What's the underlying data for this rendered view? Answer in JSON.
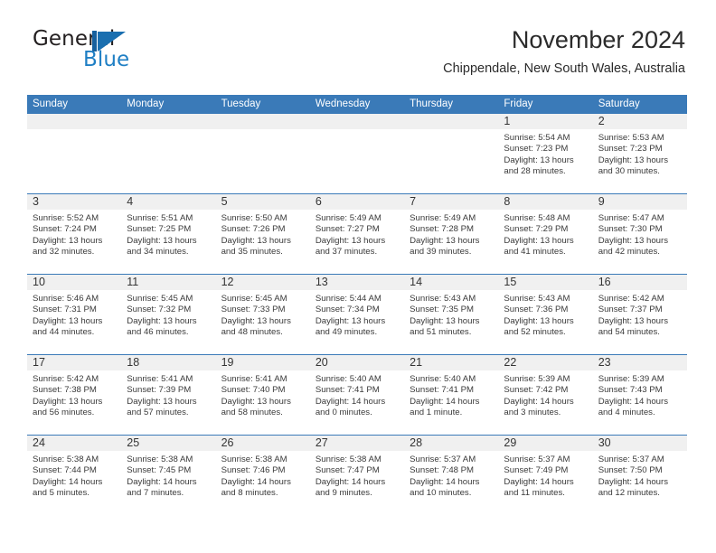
{
  "brand": {
    "name_part1": "General",
    "name_part2": "Blue",
    "mark": "blue-triangle-logo"
  },
  "header": {
    "title": "November 2024",
    "subtitle": "Chippendale, New South Wales, Australia"
  },
  "colors": {
    "header_blue": "#3a7ab8",
    "day_strip_gray": "#f0f0f0",
    "brand_blue": "#1f7fc4",
    "text": "#3a3a3a"
  },
  "weekdays": [
    "Sunday",
    "Monday",
    "Tuesday",
    "Wednesday",
    "Thursday",
    "Friday",
    "Saturday"
  ],
  "weeks": [
    [
      {
        "day": "",
        "sunrise": "",
        "sunset": "",
        "daylight1": "",
        "daylight2": ""
      },
      {
        "day": "",
        "sunrise": "",
        "sunset": "",
        "daylight1": "",
        "daylight2": ""
      },
      {
        "day": "",
        "sunrise": "",
        "sunset": "",
        "daylight1": "",
        "daylight2": ""
      },
      {
        "day": "",
        "sunrise": "",
        "sunset": "",
        "daylight1": "",
        "daylight2": ""
      },
      {
        "day": "",
        "sunrise": "",
        "sunset": "",
        "daylight1": "",
        "daylight2": ""
      },
      {
        "day": "1",
        "sunrise": "Sunrise: 5:54 AM",
        "sunset": "Sunset: 7:23 PM",
        "daylight1": "Daylight: 13 hours",
        "daylight2": "and 28 minutes."
      },
      {
        "day": "2",
        "sunrise": "Sunrise: 5:53 AM",
        "sunset": "Sunset: 7:23 PM",
        "daylight1": "Daylight: 13 hours",
        "daylight2": "and 30 minutes."
      }
    ],
    [
      {
        "day": "3",
        "sunrise": "Sunrise: 5:52 AM",
        "sunset": "Sunset: 7:24 PM",
        "daylight1": "Daylight: 13 hours",
        "daylight2": "and 32 minutes."
      },
      {
        "day": "4",
        "sunrise": "Sunrise: 5:51 AM",
        "sunset": "Sunset: 7:25 PM",
        "daylight1": "Daylight: 13 hours",
        "daylight2": "and 34 minutes."
      },
      {
        "day": "5",
        "sunrise": "Sunrise: 5:50 AM",
        "sunset": "Sunset: 7:26 PM",
        "daylight1": "Daylight: 13 hours",
        "daylight2": "and 35 minutes."
      },
      {
        "day": "6",
        "sunrise": "Sunrise: 5:49 AM",
        "sunset": "Sunset: 7:27 PM",
        "daylight1": "Daylight: 13 hours",
        "daylight2": "and 37 minutes."
      },
      {
        "day": "7",
        "sunrise": "Sunrise: 5:49 AM",
        "sunset": "Sunset: 7:28 PM",
        "daylight1": "Daylight: 13 hours",
        "daylight2": "and 39 minutes."
      },
      {
        "day": "8",
        "sunrise": "Sunrise: 5:48 AM",
        "sunset": "Sunset: 7:29 PM",
        "daylight1": "Daylight: 13 hours",
        "daylight2": "and 41 minutes."
      },
      {
        "day": "9",
        "sunrise": "Sunrise: 5:47 AM",
        "sunset": "Sunset: 7:30 PM",
        "daylight1": "Daylight: 13 hours",
        "daylight2": "and 42 minutes."
      }
    ],
    [
      {
        "day": "10",
        "sunrise": "Sunrise: 5:46 AM",
        "sunset": "Sunset: 7:31 PM",
        "daylight1": "Daylight: 13 hours",
        "daylight2": "and 44 minutes."
      },
      {
        "day": "11",
        "sunrise": "Sunrise: 5:45 AM",
        "sunset": "Sunset: 7:32 PM",
        "daylight1": "Daylight: 13 hours",
        "daylight2": "and 46 minutes."
      },
      {
        "day": "12",
        "sunrise": "Sunrise: 5:45 AM",
        "sunset": "Sunset: 7:33 PM",
        "daylight1": "Daylight: 13 hours",
        "daylight2": "and 48 minutes."
      },
      {
        "day": "13",
        "sunrise": "Sunrise: 5:44 AM",
        "sunset": "Sunset: 7:34 PM",
        "daylight1": "Daylight: 13 hours",
        "daylight2": "and 49 minutes."
      },
      {
        "day": "14",
        "sunrise": "Sunrise: 5:43 AM",
        "sunset": "Sunset: 7:35 PM",
        "daylight1": "Daylight: 13 hours",
        "daylight2": "and 51 minutes."
      },
      {
        "day": "15",
        "sunrise": "Sunrise: 5:43 AM",
        "sunset": "Sunset: 7:36 PM",
        "daylight1": "Daylight: 13 hours",
        "daylight2": "and 52 minutes."
      },
      {
        "day": "16",
        "sunrise": "Sunrise: 5:42 AM",
        "sunset": "Sunset: 7:37 PM",
        "daylight1": "Daylight: 13 hours",
        "daylight2": "and 54 minutes."
      }
    ],
    [
      {
        "day": "17",
        "sunrise": "Sunrise: 5:42 AM",
        "sunset": "Sunset: 7:38 PM",
        "daylight1": "Daylight: 13 hours",
        "daylight2": "and 56 minutes."
      },
      {
        "day": "18",
        "sunrise": "Sunrise: 5:41 AM",
        "sunset": "Sunset: 7:39 PM",
        "daylight1": "Daylight: 13 hours",
        "daylight2": "and 57 minutes."
      },
      {
        "day": "19",
        "sunrise": "Sunrise: 5:41 AM",
        "sunset": "Sunset: 7:40 PM",
        "daylight1": "Daylight: 13 hours",
        "daylight2": "and 58 minutes."
      },
      {
        "day": "20",
        "sunrise": "Sunrise: 5:40 AM",
        "sunset": "Sunset: 7:41 PM",
        "daylight1": "Daylight: 14 hours",
        "daylight2": "and 0 minutes."
      },
      {
        "day": "21",
        "sunrise": "Sunrise: 5:40 AM",
        "sunset": "Sunset: 7:41 PM",
        "daylight1": "Daylight: 14 hours",
        "daylight2": "and 1 minute."
      },
      {
        "day": "22",
        "sunrise": "Sunrise: 5:39 AM",
        "sunset": "Sunset: 7:42 PM",
        "daylight1": "Daylight: 14 hours",
        "daylight2": "and 3 minutes."
      },
      {
        "day": "23",
        "sunrise": "Sunrise: 5:39 AM",
        "sunset": "Sunset: 7:43 PM",
        "daylight1": "Daylight: 14 hours",
        "daylight2": "and 4 minutes."
      }
    ],
    [
      {
        "day": "24",
        "sunrise": "Sunrise: 5:38 AM",
        "sunset": "Sunset: 7:44 PM",
        "daylight1": "Daylight: 14 hours",
        "daylight2": "and 5 minutes."
      },
      {
        "day": "25",
        "sunrise": "Sunrise: 5:38 AM",
        "sunset": "Sunset: 7:45 PM",
        "daylight1": "Daylight: 14 hours",
        "daylight2": "and 7 minutes."
      },
      {
        "day": "26",
        "sunrise": "Sunrise: 5:38 AM",
        "sunset": "Sunset: 7:46 PM",
        "daylight1": "Daylight: 14 hours",
        "daylight2": "and 8 minutes."
      },
      {
        "day": "27",
        "sunrise": "Sunrise: 5:38 AM",
        "sunset": "Sunset: 7:47 PM",
        "daylight1": "Daylight: 14 hours",
        "daylight2": "and 9 minutes."
      },
      {
        "day": "28",
        "sunrise": "Sunrise: 5:37 AM",
        "sunset": "Sunset: 7:48 PM",
        "daylight1": "Daylight: 14 hours",
        "daylight2": "and 10 minutes."
      },
      {
        "day": "29",
        "sunrise": "Sunrise: 5:37 AM",
        "sunset": "Sunset: 7:49 PM",
        "daylight1": "Daylight: 14 hours",
        "daylight2": "and 11 minutes."
      },
      {
        "day": "30",
        "sunrise": "Sunrise: 5:37 AM",
        "sunset": "Sunset: 7:50 PM",
        "daylight1": "Daylight: 14 hours",
        "daylight2": "and 12 minutes."
      }
    ]
  ]
}
